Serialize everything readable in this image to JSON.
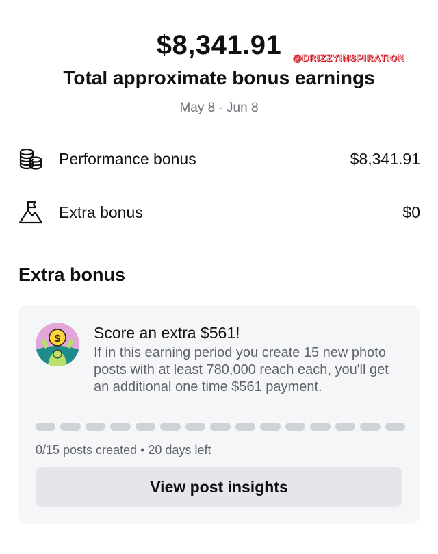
{
  "header": {
    "total_amount": "$8,341.91",
    "total_label": "Total approximate bonus earnings",
    "date_range": "May 8 - Jun 8",
    "watermark": "@DRIZZYINSPIRATION"
  },
  "bonuses": [
    {
      "label": "Performance bonus",
      "value": "$8,341.91",
      "icon": "coins-stack-icon"
    },
    {
      "label": "Extra bonus",
      "value": "$0",
      "icon": "mountain-flag-icon"
    }
  ],
  "extra_section": {
    "title": "Extra bonus",
    "card": {
      "title": "Score an extra $561!",
      "description": "If in this earning period you create 15 new photo posts with at least 780,000 reach each, you'll get an additional one time $561 payment.",
      "progress": {
        "created": 0,
        "total": 15
      },
      "status": "0/15 posts created • 20 days left",
      "button_label": "View post insights"
    }
  },
  "colors": {
    "card_bg": "#f5f6f8",
    "segment_empty": "#cfd2d6",
    "button_bg": "#e4e6ea",
    "watermark": "#d4141e"
  }
}
